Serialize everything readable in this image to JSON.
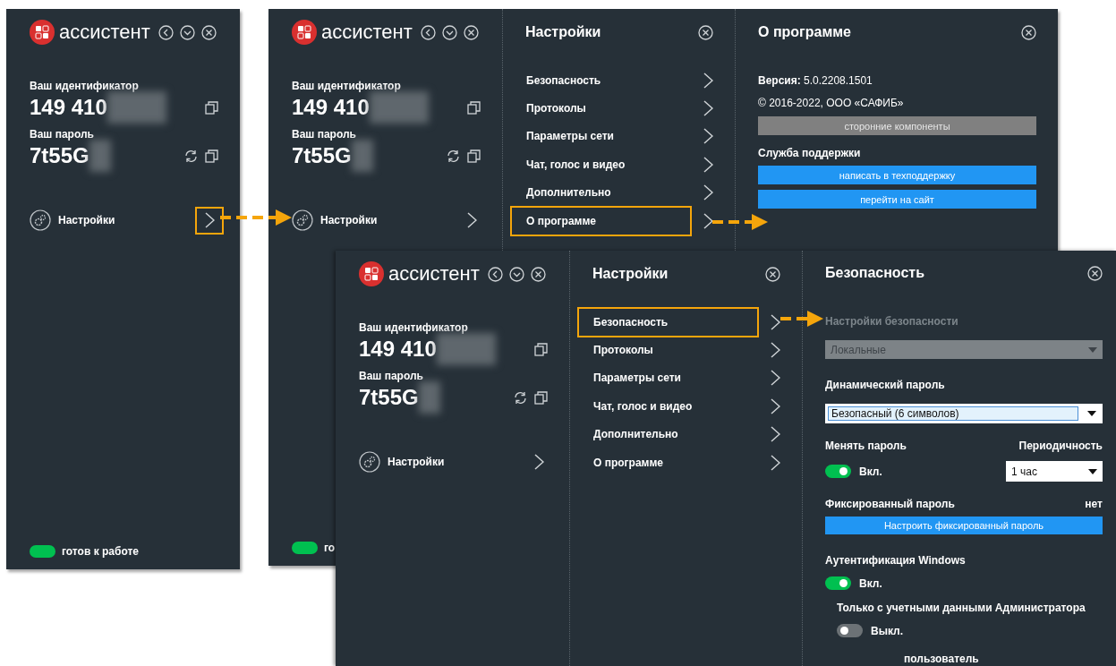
{
  "windows": [
    {
      "app_name": "ассистент",
      "id_label": "Ваш идентификатор",
      "id_value": "149 410",
      "password_label": "Ваш пароль",
      "password_value": "7t55G",
      "settings_label": "Настройки",
      "settings_highlighted": true,
      "status": "готов к работе"
    },
    {
      "app_name": "ассистент",
      "id_label": "Ваш идентификатор",
      "id_value": "149 410",
      "password_label": "Ваш пароль",
      "password_value": "7t55G",
      "settings_label": "Настройки",
      "settings_highlighted": false,
      "status": "го",
      "menu": {
        "title": "Настройки",
        "items": [
          {
            "label": "Безопасность",
            "highlighted": false
          },
          {
            "label": "Протоколы",
            "highlighted": false
          },
          {
            "label": "Параметры сети",
            "highlighted": false
          },
          {
            "label": "Чат, голос и видео",
            "highlighted": false
          },
          {
            "label": "Дополнительно",
            "highlighted": false
          },
          {
            "label": "О программе",
            "highlighted": true
          }
        ]
      },
      "detail": {
        "kind": "about",
        "title": "О программе",
        "version_label": "Версия:",
        "version": "5.0.2208.1501",
        "copyright": "© 2016-2022, ООО «САФИБ»",
        "components_button": "сторонние компоненты",
        "support_title": "Служба поддержки",
        "buttons": [
          "написать в техподдержку",
          "перейти на сайт"
        ]
      }
    },
    {
      "app_name": "ассистент",
      "id_label": "Ваш идентификатор",
      "id_value": "149 410",
      "password_label": "Ваш пароль",
      "password_value": "7t55G",
      "settings_label": "Настройки",
      "settings_highlighted": false,
      "menu": {
        "title": "Настройки",
        "items": [
          {
            "label": "Безопасность",
            "highlighted": true
          },
          {
            "label": "Протоколы",
            "highlighted": false
          },
          {
            "label": "Параметры сети",
            "highlighted": false
          },
          {
            "label": "Чат, голос и видео",
            "highlighted": false
          },
          {
            "label": "Дополнительно",
            "highlighted": false
          },
          {
            "label": "О программе",
            "highlighted": false
          }
        ]
      },
      "detail": {
        "kind": "security",
        "title": "Безопасность",
        "rows": [
          {
            "kind": "heading",
            "text": "Настройки безопасности",
            "disabled": true
          },
          {
            "kind": "dropdown",
            "value": "Локальные",
            "disabled": true,
            "focused": false
          },
          {
            "kind": "heading",
            "text": "Динамический пароль",
            "disabled": false
          },
          {
            "kind": "dropdown",
            "value": "Безопасный (6 символов)",
            "disabled": false,
            "focused": true
          },
          {
            "kind": "pair",
            "left": "Менять пароль",
            "right": "Периодичность"
          },
          {
            "kind": "toggle_select",
            "on": true,
            "label": "Вкл.",
            "select": "1 час"
          },
          {
            "kind": "pair",
            "left": "Фиксированный пароль",
            "right": "нет"
          },
          {
            "kind": "button",
            "text": "Настроить фиксированный пароль"
          },
          {
            "kind": "heading",
            "text": "Аутентификация Windows",
            "disabled": false
          },
          {
            "kind": "toggle",
            "on": true,
            "label": "Вкл.",
            "sub": false
          },
          {
            "kind": "subheading",
            "text": "Только с учетными данными Администратора"
          },
          {
            "kind": "toggle",
            "on": false,
            "label": "Выкл.",
            "sub": true
          },
          {
            "kind": "tail",
            "text": "пользователь"
          }
        ]
      }
    }
  ]
}
